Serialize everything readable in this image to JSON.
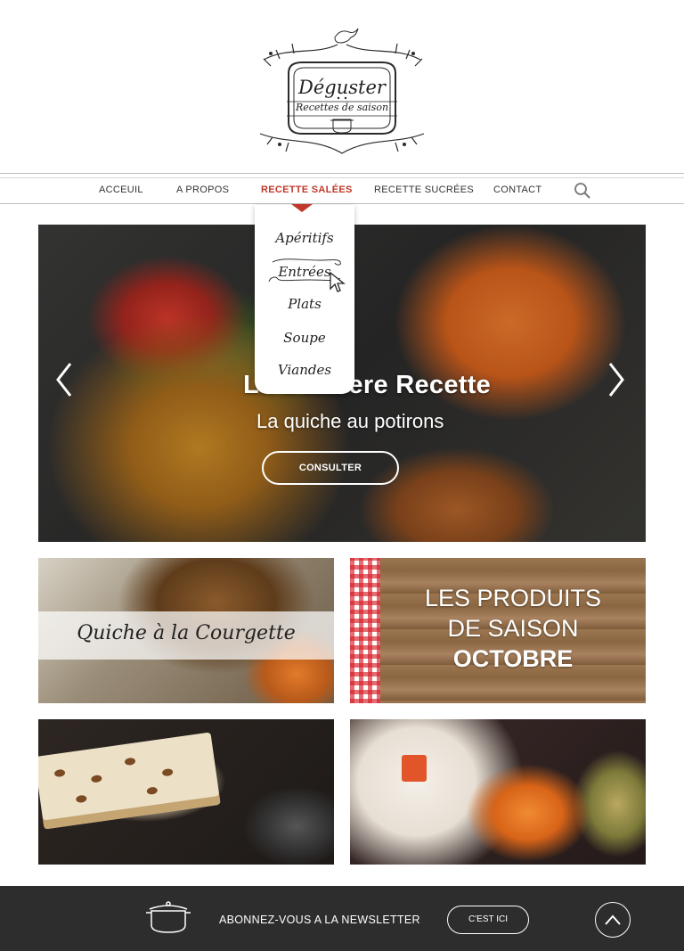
{
  "logo": {
    "title": "Déguster",
    "subtitle": "Recettes de saison"
  },
  "nav": {
    "items": [
      {
        "label": "ACCEUIL"
      },
      {
        "label": "A PROPOS"
      },
      {
        "label": "RECETTE SALÉES",
        "active": true
      },
      {
        "label": "RECETTE SUCRÉES"
      },
      {
        "label": "CONTACT"
      }
    ],
    "search_icon": "search-icon",
    "accent_color": "#c0392b"
  },
  "dropdown": {
    "items": [
      "Apéritifs",
      "Entrées",
      "Plats",
      "Soupe",
      "Viandes"
    ],
    "hovered": "Entrées"
  },
  "hero": {
    "title": "La Derniere Recette",
    "subtitle": "La quiche au potirons",
    "button": "CONSULTER",
    "prev_icon": "chevron-left-icon",
    "next_icon": "chevron-right-icon"
  },
  "tiles": {
    "quiche": "Quiche à la Courgette",
    "saison_line1": "LES PRODUITS",
    "saison_line2": "DE SAISON",
    "saison_line3": "OCTOBRE"
  },
  "footer": {
    "newsletter": "ABONNEZ-VOUS A LA NEWSLETTER",
    "button": "C'EST ICI",
    "pot_icon": "cooking-pot-icon",
    "top_icon": "chevron-up-icon",
    "background": "#2d2d2d"
  }
}
